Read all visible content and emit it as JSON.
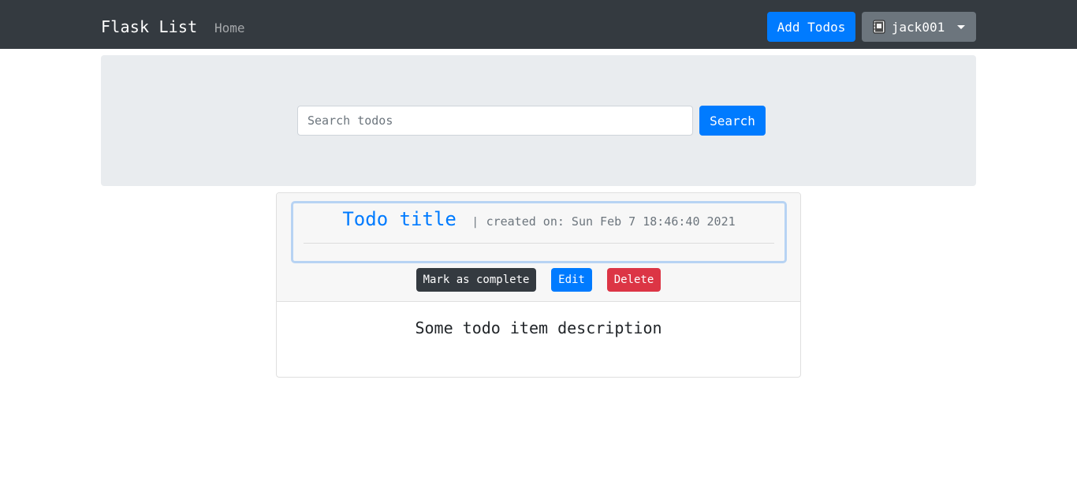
{
  "navbar": {
    "brand": "Flask List",
    "home_link": "Home",
    "add_button": "Add Todos",
    "user_button": "jack001"
  },
  "search": {
    "placeholder": "Search todos",
    "value": "",
    "button_label": "Search"
  },
  "todo": {
    "title": "Todo title",
    "separator": "|",
    "created": "created on: Sun Feb 7 18:46:40 2021",
    "description": "Some todo item description",
    "actions": {
      "complete": "Mark as complete",
      "edit": "Edit",
      "delete": "Delete"
    }
  },
  "icons": {
    "user_icon": "notebook-icon",
    "dropdown_icon": "caret-down-icon"
  },
  "colors": {
    "navbar": "#343a40",
    "primary": "#007bff",
    "secondary": "#6c757d",
    "danger": "#dc3545",
    "dark": "#343a40",
    "jumbotron": "#e9ecef"
  }
}
